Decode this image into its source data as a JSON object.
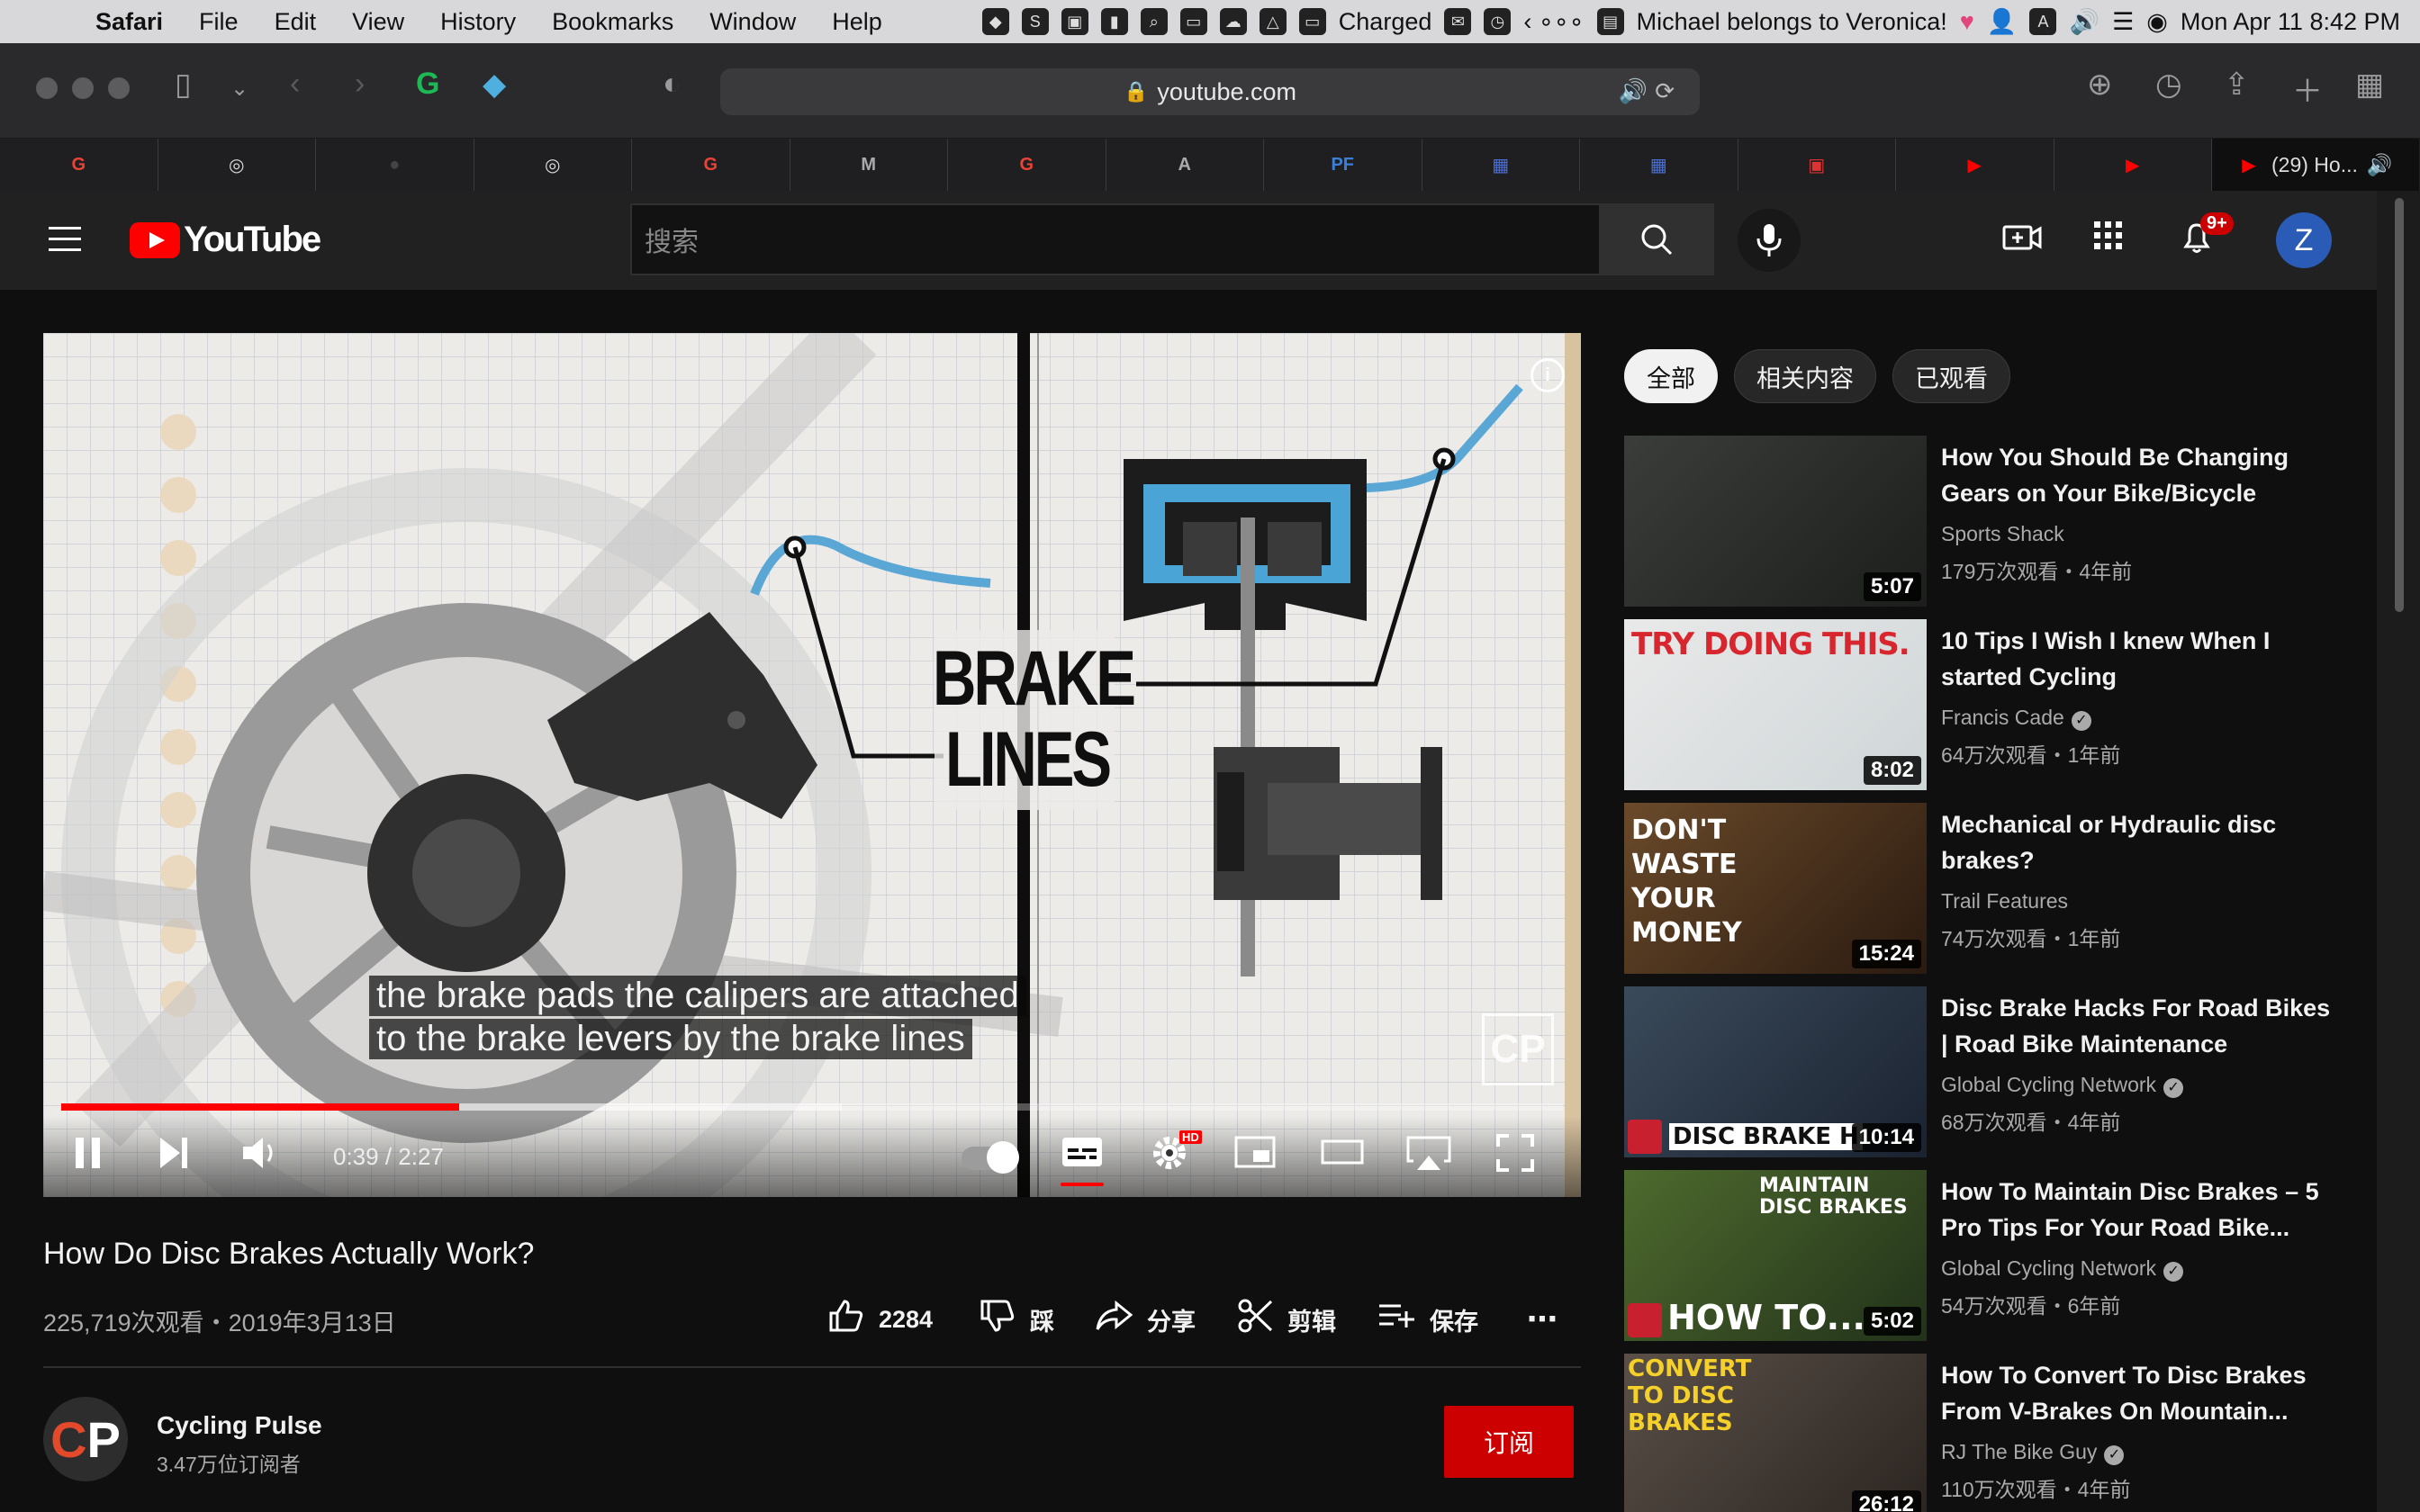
{
  "menubar": {
    "apple": "",
    "app": "Safari",
    "items": [
      "File",
      "Edit",
      "View",
      "History",
      "Bookmarks",
      "Window",
      "Help"
    ],
    "battery": "Charged",
    "song": "Michael belongs to Veronica!",
    "datetime": "Mon Apr 11  8:42 PM"
  },
  "browser": {
    "url": "youtube.com",
    "tabs": [
      {
        "icon": "google-favicon",
        "glyph": "G",
        "color": "#ea4335"
      },
      {
        "icon": "bike-favicon",
        "glyph": "◎",
        "color": "#ddd"
      },
      {
        "icon": "dark-favicon",
        "glyph": "●",
        "color": "#444"
      },
      {
        "icon": "bike-favicon",
        "glyph": "◎",
        "color": "#ddd"
      },
      {
        "icon": "google-favicon",
        "glyph": "G",
        "color": "#ea4335"
      },
      {
        "icon": "m-favicon",
        "glyph": "M",
        "color": "#aaa"
      },
      {
        "icon": "google-favicon",
        "glyph": "G",
        "color": "#ea4335"
      },
      {
        "icon": "a-favicon",
        "glyph": "A",
        "color": "#aaa"
      },
      {
        "icon": "pf-favicon",
        "glyph": "PF",
        "color": "#3c7fd6"
      },
      {
        "icon": "pattern-favicon",
        "glyph": "▦",
        "color": "#4a6fd6"
      },
      {
        "icon": "pattern-favicon",
        "glyph": "▦",
        "color": "#4a6fd6"
      },
      {
        "icon": "toolbox-favicon",
        "glyph": "▣",
        "color": "#d33"
      },
      {
        "icon": "youtube-favicon",
        "glyph": "▶",
        "color": "#f00"
      },
      {
        "icon": "youtube-favicon",
        "glyph": "▶",
        "color": "#f00"
      }
    ],
    "active_tab": "(29) Ho..."
  },
  "youtube": {
    "logo_text": "YouTube",
    "search_placeholder": "搜索",
    "notifications_badge": "9+",
    "avatar_letter": "Z"
  },
  "player": {
    "caption_line1": "the brake pads the calipers are attached",
    "caption_line2": "to the brake levers by the brake lines",
    "overlay_title_1": "BRAKE",
    "overlay_title_2": "LINES",
    "watermark": "CP",
    "info": "i",
    "time_current": "0:39",
    "time_total": "2:27",
    "time_display": "0:39 / 2:27",
    "progress_fraction": 0.265,
    "buffered_fraction": 0.52,
    "hd_badge": "HD"
  },
  "video": {
    "title": "How Do Disc Brakes Actually Work?",
    "meta": "225,719次观看・2019年3月13日",
    "likes": "2284",
    "dislike_label": "踩",
    "share_label": "分享",
    "clip_label": "剪辑",
    "save_label": "保存",
    "more": "⋯"
  },
  "channel": {
    "name": "Cycling Pulse",
    "subscribers": "3.47万位订阅者",
    "avatar_c": "C",
    "avatar_p": "P",
    "subscribe_label": "订阅"
  },
  "sidebar": {
    "chips": [
      "全部",
      "相关内容",
      "已观看"
    ],
    "recommendations": [
      {
        "title": "How You Should Be Changing Gears on Your Bike/Bicycle",
        "channel": "Sports Shack",
        "verified": false,
        "stats": "179万次观看・4年前",
        "duration": "5:07",
        "thumb_text": "",
        "thumb_colors": [
          "#3a3d3a",
          "#1c1e1c"
        ]
      },
      {
        "title": "10 Tips I Wish I knew When I started Cycling",
        "channel": "Francis Cade",
        "verified": true,
        "stats": "64万次观看・1年前",
        "duration": "8:02",
        "thumb_text": "TRY DOING THIS.",
        "thumb_colors": [
          "#e9e9e9",
          "#cfd6d8"
        ]
      },
      {
        "title": "Mechanical or Hydraulic disc brakes?",
        "channel": "Trail Features",
        "verified": false,
        "stats": "74万次观看・1年前",
        "duration": "15:24",
        "thumb_text": "DON'T WASTE YOUR MONEY",
        "thumb_colors": [
          "#6a4a2a",
          "#2a1a10"
        ]
      },
      {
        "title": "Disc Brake Hacks For Road Bikes | Road Bike Maintenance",
        "channel": "Global Cycling Network",
        "verified": true,
        "stats": "68万次观看・4年前",
        "duration": "10:14",
        "thumb_text": "DISC BRAKE H",
        "thumb_colors": [
          "#3a4a5a",
          "#1a2230"
        ]
      },
      {
        "title": "How To Maintain Disc Brakes – 5 Pro Tips For Your Road Bike...",
        "channel": "Global Cycling Network",
        "verified": true,
        "stats": "54万次观看・6年前",
        "duration": "5:02",
        "thumb_text": "HOW TO...",
        "thumb_text_2": "MAINTAIN DISC BRAKES",
        "thumb_colors": [
          "#4e6a2e",
          "#22321a"
        ]
      },
      {
        "title": "How To Convert To Disc Brakes From V-Brakes On Mountain...",
        "channel": "RJ The Bike Guy",
        "verified": true,
        "stats": "110万次观看・4年前",
        "duration": "26:12",
        "thumb_text": "CONVERT TO DISC BRAKES",
        "thumb_colors": [
          "#5a5048",
          "#2a2420"
        ]
      }
    ]
  }
}
